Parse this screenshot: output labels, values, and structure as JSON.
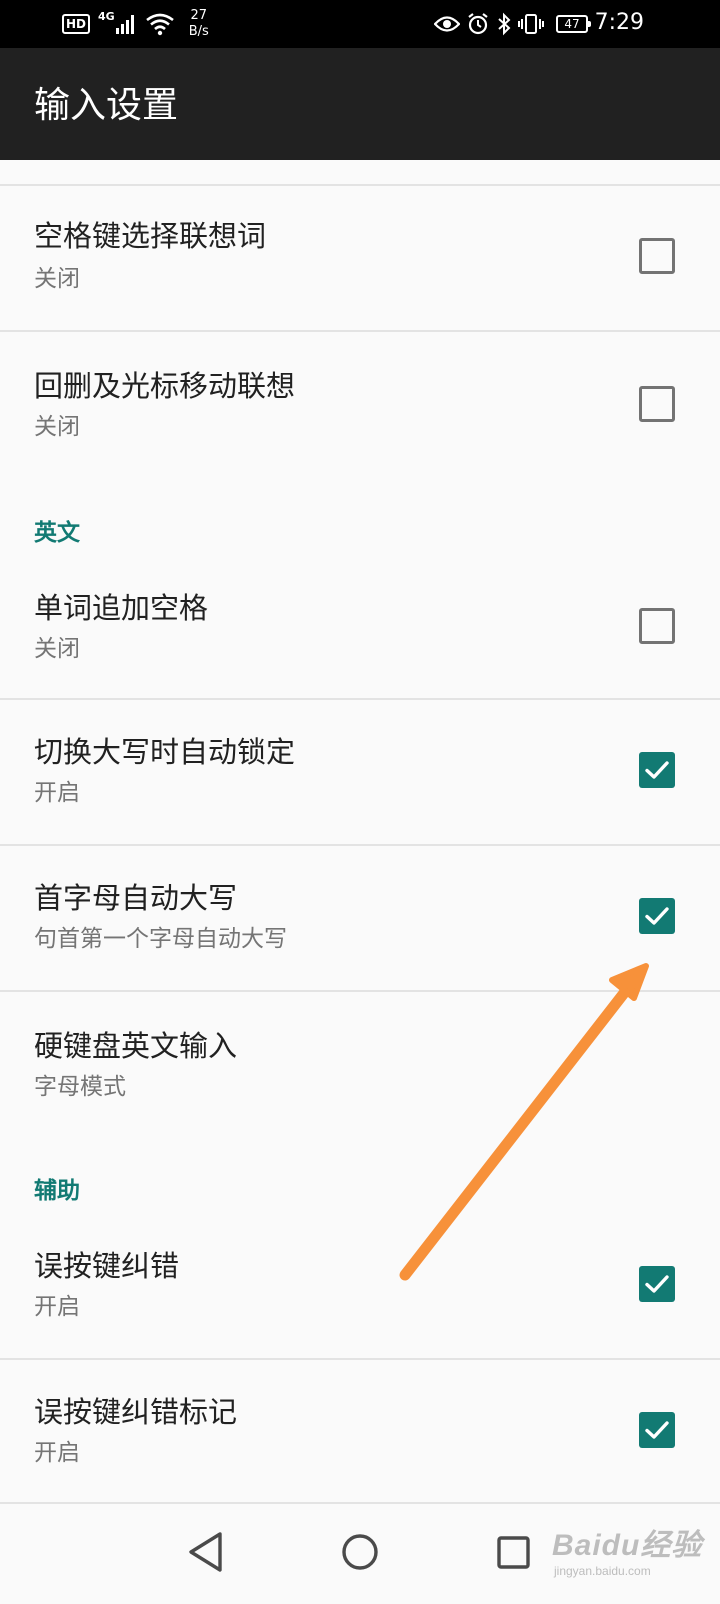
{
  "status_bar": {
    "hd_label": "HD",
    "network_type": "4G",
    "speed_value": "27",
    "speed_unit": "B/s",
    "battery_level": "47",
    "time": "7:29"
  },
  "header": {
    "title": "输入设置"
  },
  "settings": {
    "space_select": {
      "title": "空格键选择联想词",
      "summary": "关闭",
      "checked": false
    },
    "backspace_predict": {
      "title": "回删及光标移动联想",
      "summary": "关闭",
      "checked": false
    },
    "english_section": "英文",
    "word_space": {
      "title": "单词追加空格",
      "summary": "关闭",
      "checked": false
    },
    "caps_lock": {
      "title": "切换大写时自动锁定",
      "summary": "开启",
      "checked": true
    },
    "auto_capitalize": {
      "title": "首字母自动大写",
      "summary": "句首第一个字母自动大写",
      "checked": true
    },
    "hardware_keyboard": {
      "title": "硬键盘英文输入",
      "summary": "字母模式"
    },
    "assist_section": "辅助",
    "typo_correction": {
      "title": "误按键纠错",
      "summary": "开启",
      "checked": true
    },
    "typo_mark": {
      "title": "误按键纠错标记",
      "summary": "开启",
      "checked": true
    }
  },
  "annotation": {
    "arrow_color": "#f7913a"
  },
  "colors": {
    "accent": "#127a73",
    "toolbar": "#212121",
    "background": "#fafafa"
  },
  "watermark": {
    "brand": "Baidu经验",
    "url": "jingyan.baidu.com"
  }
}
